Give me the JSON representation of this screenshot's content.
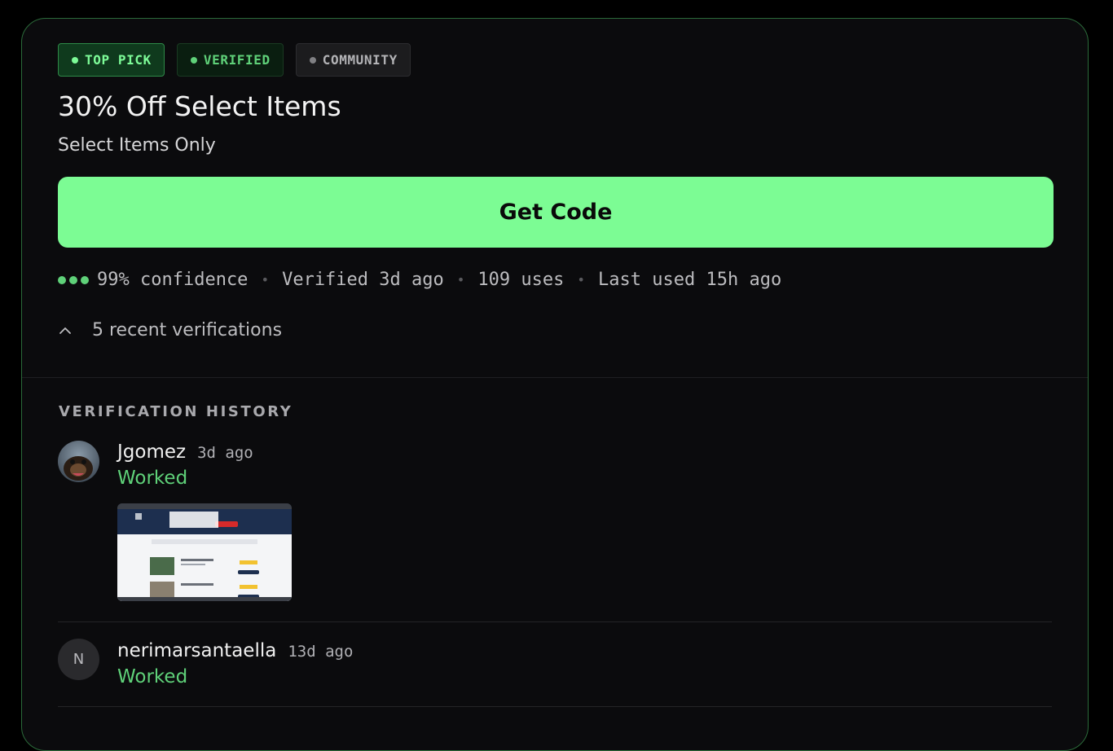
{
  "badges": {
    "top_pick": "TOP PICK",
    "verified": "VERIFIED",
    "community": "COMMUNITY"
  },
  "offer": {
    "title": "30% Off Select Items",
    "subtitle": "Select Items Only",
    "cta_label": "Get Code"
  },
  "stats": {
    "confidence": "99% confidence",
    "verified": "Verified 3d ago",
    "uses": "109 uses",
    "last_used": "Last used 15h ago",
    "separator": "•"
  },
  "toggle": {
    "label": "5 recent verifications"
  },
  "history": {
    "title": "VERIFICATION HISTORY",
    "entries": [
      {
        "username": "Jgomez",
        "ago": "3d ago",
        "status": "Worked"
      },
      {
        "username": "nerimarsantaella",
        "ago": "13d ago",
        "status": "Worked",
        "initial": "N"
      }
    ]
  },
  "colors": {
    "accent": "#7cfc94",
    "success": "#5fd179",
    "card_border": "#2b6a3a",
    "card_bg": "#0b0b0d"
  },
  "icons": {
    "toggle": "chevron-up-icon",
    "dot": "status-dot-icon"
  }
}
